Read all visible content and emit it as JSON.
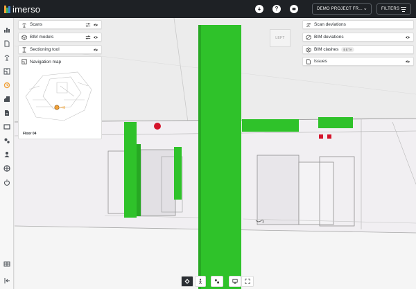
{
  "app": {
    "name": "imerso",
    "project_selector": "DEMO PROJECT FR...",
    "filters_label": "FILTERS"
  },
  "top_icons": [
    "download-icon",
    "help-icon",
    "account-icon"
  ],
  "sidebar": {
    "items": [
      "chart-icon",
      "document-icon",
      "scan-antenna-icon",
      "floorplan-icon",
      "progress-icon",
      "building-icon",
      "report-icon",
      "panel-icon",
      "settings-icon",
      "user-icon",
      "globe-icon",
      "power-icon"
    ],
    "bottom": [
      "layout-icon",
      "collapse-icon"
    ]
  },
  "left_panel": {
    "scans": {
      "label": "Scans"
    },
    "bim_models": {
      "label": "BIM models"
    },
    "sectioning_tool": {
      "label": "Sectioning tool"
    },
    "navigation_map": {
      "label": "Navigation map",
      "floor": "Floor 04"
    }
  },
  "right_panel": {
    "scan_deviations": {
      "label": "Scan deviations"
    },
    "bim_deviations": {
      "label": "BIM deviations"
    },
    "bim_clashes": {
      "label": "BIM clashes",
      "badge": "BETA"
    },
    "issues": {
      "label": "Issues"
    }
  },
  "viewcube": {
    "label": "LEFT"
  },
  "colors": {
    "topbar": "#1e2125",
    "bim_green": "#2fc22a",
    "issue_red": "#d4142b",
    "accent_orange": "#f2a23a"
  },
  "bottom_tools": [
    "navigate-icon",
    "walk-icon",
    "measure-icon",
    "presentation-icon",
    "fullscreen-icon"
  ]
}
